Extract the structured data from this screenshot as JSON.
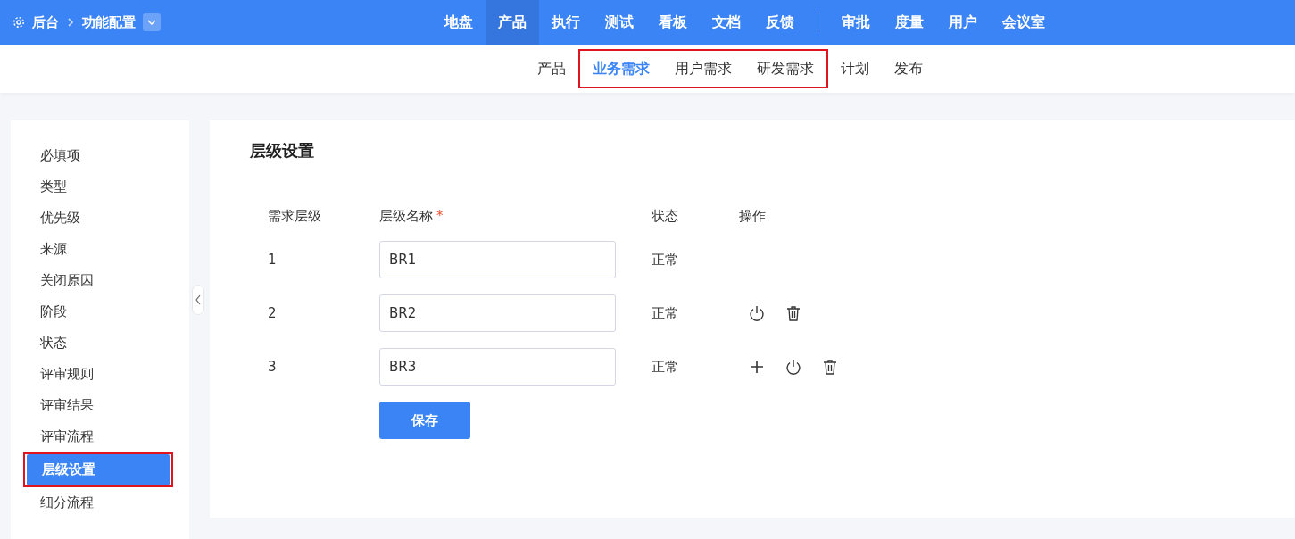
{
  "breadcrumb": {
    "home": "后台",
    "current": "功能配置"
  },
  "top_nav": [
    {
      "label": "地盘",
      "selected": false
    },
    {
      "label": "产品",
      "selected": true
    },
    {
      "label": "执行",
      "selected": false
    },
    {
      "label": "测试",
      "selected": false
    },
    {
      "label": "看板",
      "selected": false
    },
    {
      "label": "文档",
      "selected": false
    },
    {
      "label": "反馈",
      "selected": false
    },
    {
      "kind": "divider"
    },
    {
      "label": "审批",
      "selected": false
    },
    {
      "label": "度量",
      "selected": false
    },
    {
      "label": "用户",
      "selected": false
    },
    {
      "label": "会议室",
      "selected": false
    }
  ],
  "sub_nav": [
    {
      "label": "产品",
      "selected": false,
      "highlighted": false
    },
    {
      "label": "业务需求",
      "selected": true,
      "highlighted": true
    },
    {
      "label": "用户需求",
      "selected": false,
      "highlighted": true
    },
    {
      "label": "研发需求",
      "selected": false,
      "highlighted": true
    },
    {
      "label": "计划",
      "selected": false,
      "highlighted": false
    },
    {
      "label": "发布",
      "selected": false,
      "highlighted": false
    }
  ],
  "sidebar": {
    "items": [
      {
        "label": "必填项",
        "selected": false,
        "highlighted": false
      },
      {
        "label": "类型",
        "selected": false,
        "highlighted": false
      },
      {
        "label": "优先级",
        "selected": false,
        "highlighted": false
      },
      {
        "label": "来源",
        "selected": false,
        "highlighted": false
      },
      {
        "label": "关闭原因",
        "selected": false,
        "highlighted": false
      },
      {
        "label": "阶段",
        "selected": false,
        "highlighted": false
      },
      {
        "label": "状态",
        "selected": false,
        "highlighted": false
      },
      {
        "label": "评审规则",
        "selected": false,
        "highlighted": false
      },
      {
        "label": "评审结果",
        "selected": false,
        "highlighted": false
      },
      {
        "label": "评审流程",
        "selected": false,
        "highlighted": false
      },
      {
        "label": "层级设置",
        "selected": true,
        "highlighted": true
      },
      {
        "label": "细分流程",
        "selected": false,
        "highlighted": false
      }
    ]
  },
  "panel": {
    "title": "层级设置",
    "table": {
      "columns": [
        {
          "label": "需求层级"
        },
        {
          "label": "层级名称",
          "required_mark": "*"
        },
        {
          "label": "状态"
        },
        {
          "label": "操作"
        }
      ],
      "rows": [
        {
          "level": "1",
          "name": "BR1",
          "status": "正常",
          "actions": []
        },
        {
          "level": "2",
          "name": "BR2",
          "status": "正常",
          "actions": [
            {
              "kind": "power"
            },
            {
              "kind": "delete"
            }
          ]
        },
        {
          "level": "3",
          "name": "BR3",
          "status": "正常",
          "actions": [
            {
              "kind": "add"
            },
            {
              "kind": "power"
            },
            {
              "kind": "delete"
            }
          ]
        }
      ]
    },
    "save_button": "保存"
  }
}
